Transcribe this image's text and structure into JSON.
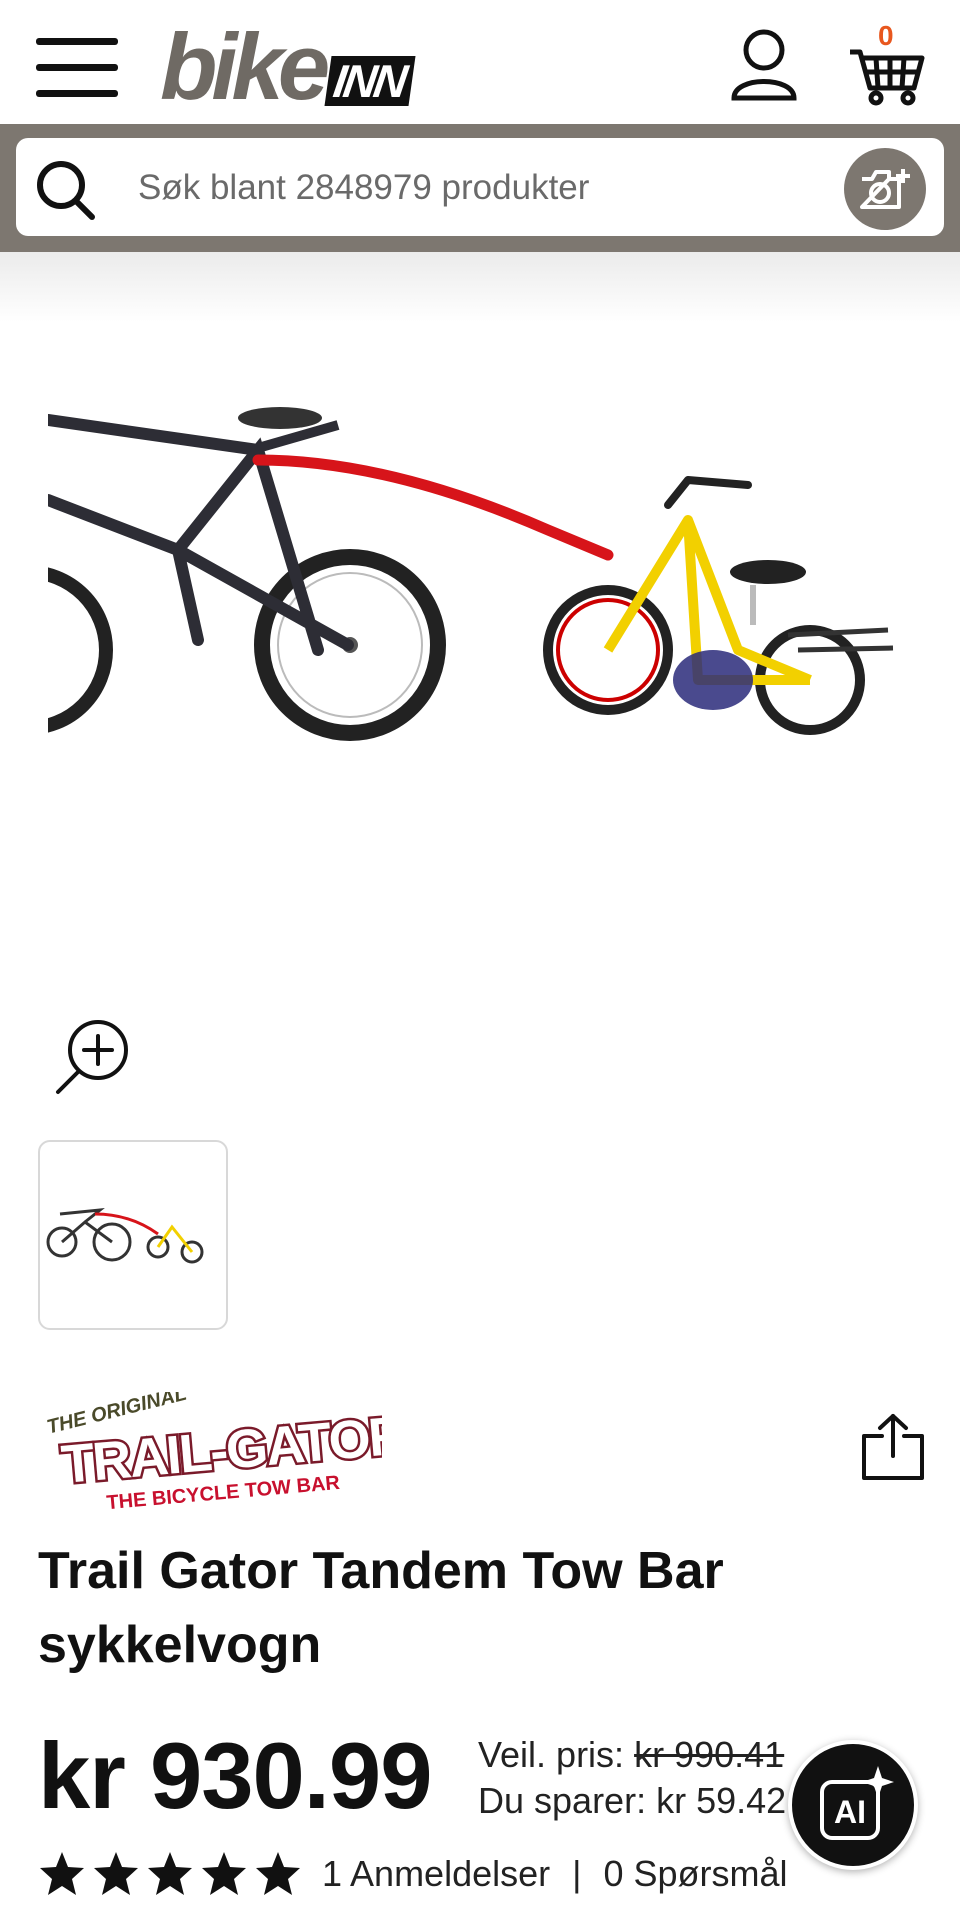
{
  "header": {
    "logo_main": "bike",
    "logo_badge": "INN",
    "cart_count": "0",
    "icons": [
      "hamburger-menu-icon",
      "user-icon",
      "cart-icon"
    ]
  },
  "search": {
    "placeholder": "Søk blant 2848979 produkter",
    "icons": [
      "search-icon",
      "camera-icon"
    ]
  },
  "gallery": {
    "icons": [
      "zoom-in-icon"
    ],
    "thumbnails": 1
  },
  "product": {
    "brand": "Trail Gator",
    "title": "Trail Gator Tandem Tow Bar sykkelvogn",
    "price": "kr 930.99",
    "rrp_label": "Veil. pris:",
    "rrp_value": "kr 990.41",
    "saving_label": "Du sparer:",
    "saving_value": "kr 59.42",
    "rating": 5,
    "reviews": "1 Anmeldelser",
    "questions": "0 Spørsmål"
  },
  "colors": {
    "brand_gray": "#7d7770",
    "cart_badge": "#e8571e",
    "text": "#111111"
  },
  "floating": {
    "ai_label": "AI"
  }
}
